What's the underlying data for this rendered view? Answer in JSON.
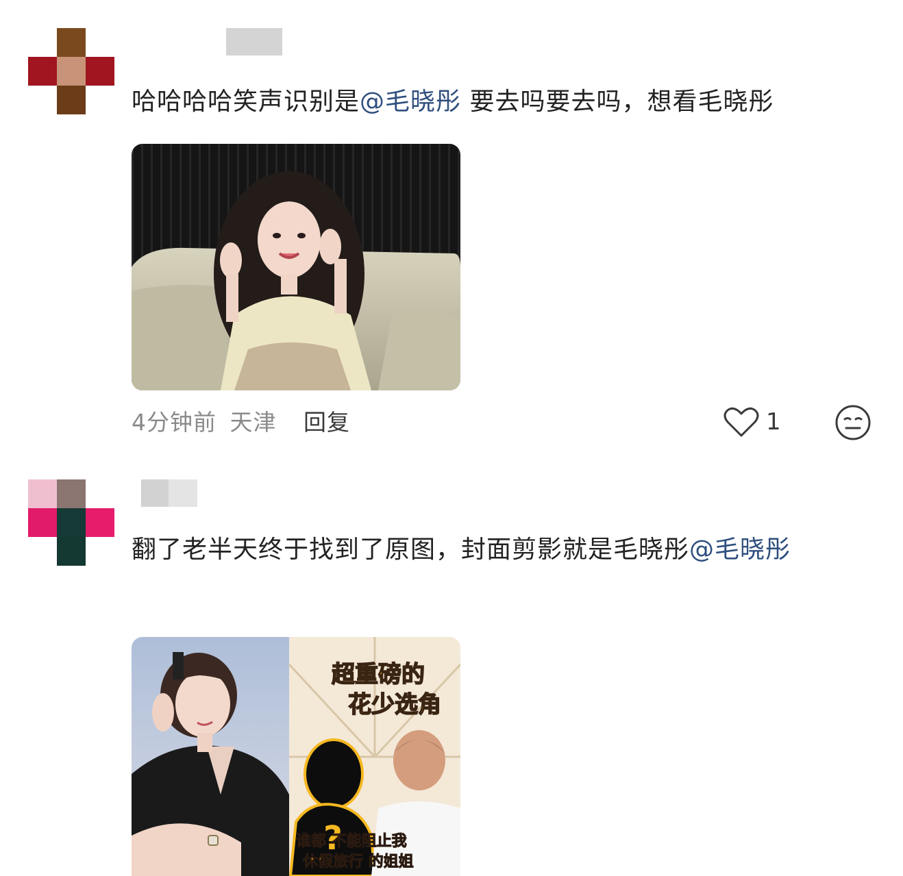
{
  "comments": [
    {
      "text_before": "哈哈哈哈笑声识别是",
      "mention": "@毛晓彤",
      "text_after": " 要去吗要去吗，想看毛晓彤",
      "time": "4分钟前",
      "location": "天津",
      "reply_label": "回复",
      "like_count": "1",
      "avatar_colors": [
        "#7a4a1e",
        "#a01520",
        "#c89378",
        "#a01520",
        "#6b3c17"
      ]
    },
    {
      "text_before": "翻了老半天终于找到了原图，封面剪影就是毛晓彤",
      "mention": "@毛晓彤",
      "text_after": "",
      "image_caption_top": "超重磅的",
      "image_caption_mid": "花少选角",
      "image_caption_bottom_1": "谁都 不能阻止我",
      "image_caption_bottom_2": "休假旅行 的姐姐",
      "avatar_colors": [
        "#efbfd0",
        "#8b7570",
        "#e21a6a",
        "#163a36",
        "#e51d6b",
        "#143832"
      ]
    }
  ],
  "icons": {
    "like": "heart-outline-icon",
    "emoji": "neutral-face-icon"
  }
}
